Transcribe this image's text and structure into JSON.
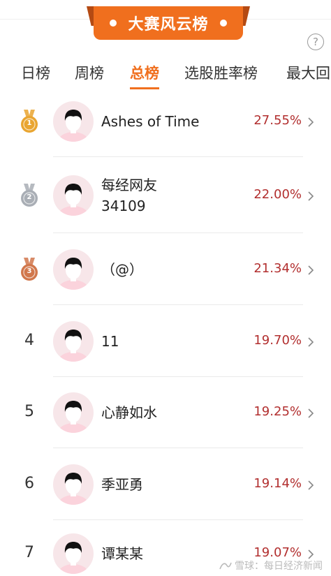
{
  "banner": {
    "title": "大赛风云榜"
  },
  "help": {
    "label": "?"
  },
  "tabs": [
    {
      "label": "日榜",
      "active": false
    },
    {
      "label": "周榜",
      "active": false
    },
    {
      "label": "总榜",
      "active": true
    },
    {
      "label": "选股胜率榜",
      "active": false
    },
    {
      "label": "最大回"
    }
  ],
  "rows": [
    {
      "rank": "1",
      "medal": "gold",
      "name_line1": "Ashes of Time",
      "name_line2": "",
      "rate": "27.55%"
    },
    {
      "rank": "2",
      "medal": "silver",
      "name_line1": "每经网友",
      "name_line2": "34109",
      "rate": "22.00%"
    },
    {
      "rank": "3",
      "medal": "bronze",
      "name_line1": "（@）",
      "name_line2": "",
      "rate": "21.34%"
    },
    {
      "rank": "4",
      "medal": "",
      "name_line1": "11",
      "name_line2": "",
      "rate": "19.70%"
    },
    {
      "rank": "5",
      "medal": "",
      "name_line1": "心静如水",
      "name_line2": "",
      "rate": "19.25%"
    },
    {
      "rank": "6",
      "medal": "",
      "name_line1": "季亚勇",
      "name_line2": "",
      "rate": "19.14%"
    },
    {
      "rank": "7",
      "medal": "",
      "name_line1": "谭某某",
      "name_line2": "",
      "rate": "19.07%"
    }
  ],
  "colors": {
    "accent": "#f06f1e",
    "rate": "#b22f2f",
    "gold": "#e9a531",
    "silver": "#a9aeb5",
    "bronze": "#d1774c"
  },
  "watermark": {
    "text": "雪球：每日经济新闻"
  }
}
